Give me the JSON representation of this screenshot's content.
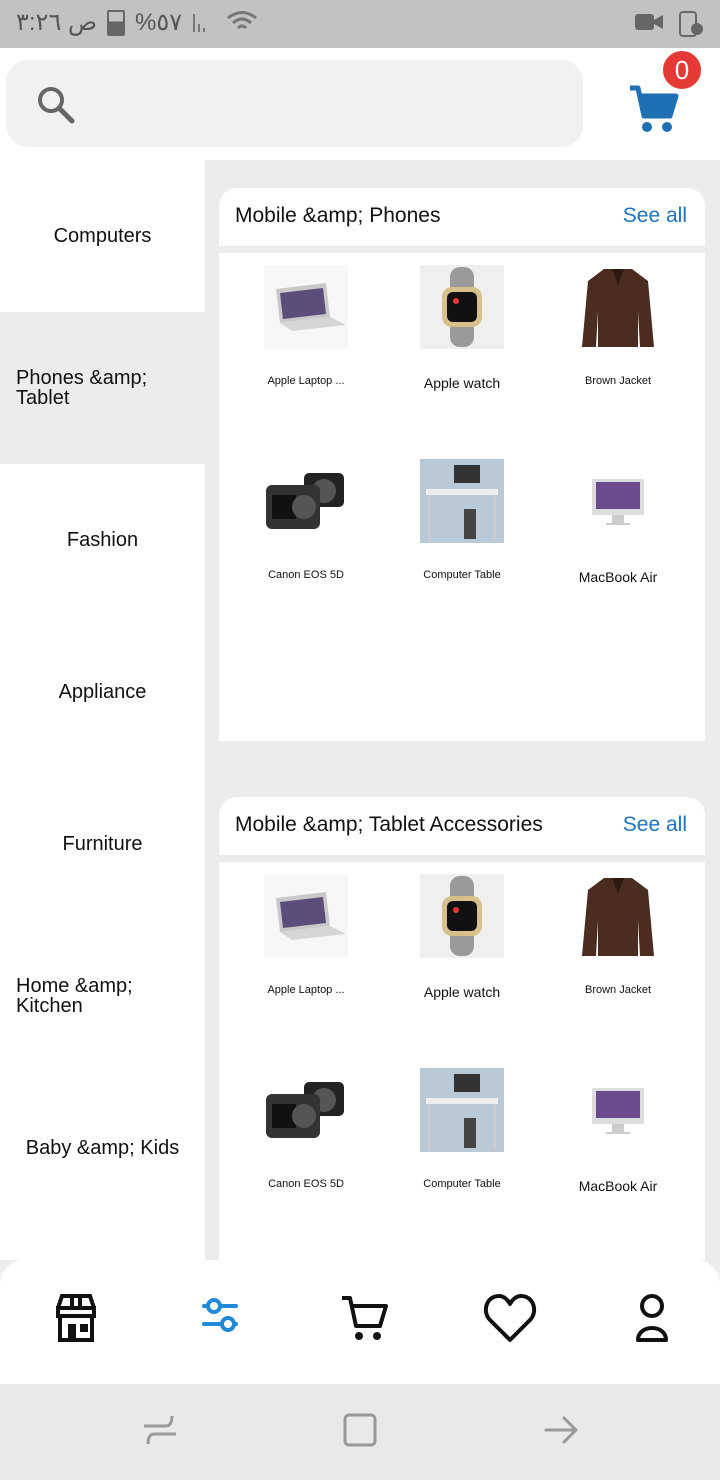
{
  "status_bar": {
    "time": "ص ٣:٢٦",
    "battery": "%٥٧"
  },
  "header": {
    "cart_count": "0"
  },
  "categories": [
    {
      "label": "Computers"
    },
    {
      "label": "Phones &amp; Tablet"
    },
    {
      "label": "Fashion"
    },
    {
      "label": "Appliance"
    },
    {
      "label": "Furniture"
    },
    {
      "label": "Home &amp; Kitchen"
    },
    {
      "label": "Baby &amp; Kids"
    }
  ],
  "sections": [
    {
      "title": "Mobile &amp; Phones",
      "see_all": "See all",
      "products": [
        {
          "name": "Apple Laptop ...",
          "image": "laptop-image"
        },
        {
          "name": "Apple watch",
          "image": "watch-image"
        },
        {
          "name": "Brown Jacket",
          "image": "jacket-image"
        },
        {
          "name": "Canon EOS 5D",
          "image": "camera-image"
        },
        {
          "name": "Computer Table",
          "image": "desk-image"
        },
        {
          "name": "MacBook Air",
          "image": "imac-image"
        }
      ]
    },
    {
      "title": "Mobile &amp; Tablet Accessories",
      "see_all": "See all",
      "products": [
        {
          "name": "Apple Laptop ...",
          "image": "laptop-image"
        },
        {
          "name": "Apple watch",
          "image": "watch-image"
        },
        {
          "name": "Brown Jacket",
          "image": "jacket-image"
        },
        {
          "name": "Canon EOS 5D",
          "image": "camera-image"
        },
        {
          "name": "Computer Table",
          "image": "desk-image"
        },
        {
          "name": "MacBook Air",
          "image": "imac-image"
        }
      ]
    }
  ],
  "bottom_nav": [
    {
      "icon": "store-icon"
    },
    {
      "icon": "filter-icon",
      "active": true
    },
    {
      "icon": "cart-icon"
    },
    {
      "icon": "heart-icon"
    },
    {
      "icon": "user-icon"
    }
  ],
  "colors": {
    "accent": "#1b73c2",
    "badge": "#e53935",
    "cart": "#1f6fb5",
    "selected_category": "#ececec"
  }
}
